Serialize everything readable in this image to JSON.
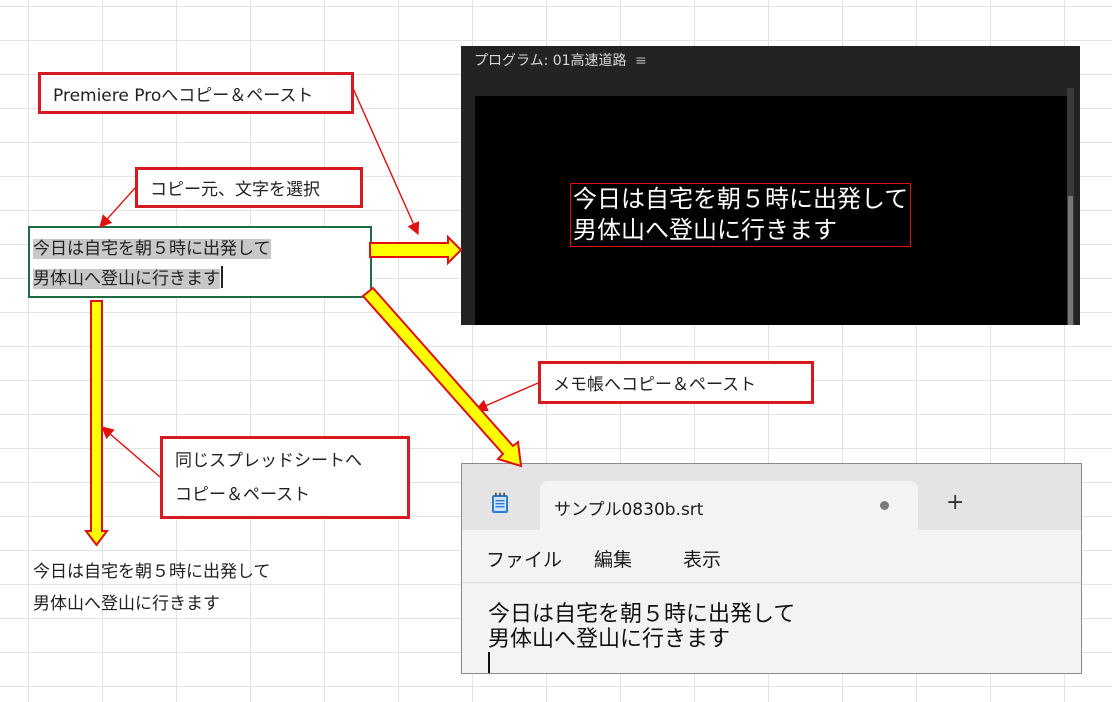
{
  "callouts": {
    "premiere": "Premiere Proへコピー＆ペースト",
    "source": "コピー元、文字を選択",
    "notepad": "メモ帳へコピー＆ペースト",
    "same_sheet_line1": "同じスプレッドシートへ",
    "same_sheet_line2": "コピー＆ペースト"
  },
  "source_cell": {
    "line1": "今日は自宅を朝５時に出発して",
    "line2": "男体山へ登山に行きます"
  },
  "pasted_cell": {
    "line1": "今日は自宅を朝５時に出発して",
    "line2": "男体山へ登山に行きます"
  },
  "premiere": {
    "title": "プログラム: 01高速道路",
    "menu_icon": "≡",
    "caption_line1": "今日は自宅を朝５時に出発して",
    "caption_line2": "男体山へ登山に行きます"
  },
  "notepad": {
    "tab_title": "サンプル0830b.srt",
    "new_tab": "+",
    "menu": [
      "ファイル",
      "編集",
      "表示"
    ],
    "text_line1": "今日は自宅を朝５時に出発して",
    "text_line2": "男体山へ登山に行きます"
  },
  "colors": {
    "callout_border": "#d71920",
    "arrow_fill": "#ffff00",
    "arrow_outline": "#e01010",
    "selected_cell_border": "#1f6e43"
  }
}
